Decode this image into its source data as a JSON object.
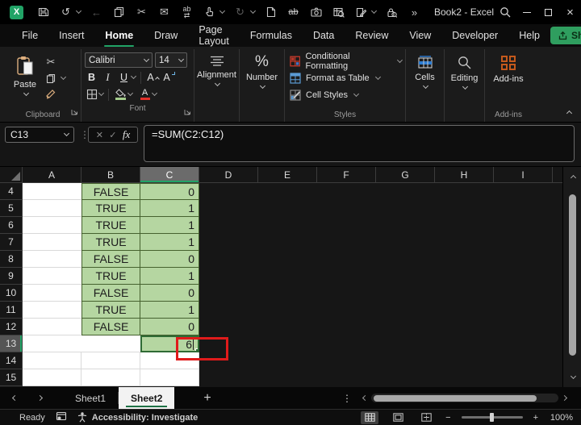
{
  "window": {
    "title": "Book2 - Excel",
    "controls": {
      "close": "×"
    }
  },
  "qat_icons": [
    "excel-logo",
    "save",
    "undo",
    "back",
    "copy",
    "cut",
    "email",
    "find-replace",
    "touch-mouse-mode",
    "redo",
    "new-file",
    "strikethrough",
    "camera",
    "workbook-statistics",
    "edit-form",
    "permissions",
    "more"
  ],
  "qat_text": {
    "replace": "ab",
    "strikethrough": "ab",
    "more": "»"
  },
  "ribbon_tabs": [
    "File",
    "Insert",
    "Home",
    "Draw",
    "Page Layout",
    "Formulas",
    "Data",
    "Review",
    "View",
    "Developer",
    "Help"
  ],
  "active_tab": "Home",
  "share": {
    "label": "Share"
  },
  "ribbon": {
    "clipboard": {
      "paste": "Paste",
      "label": "Clipboard"
    },
    "font": {
      "name": "Calibri",
      "size": "14",
      "bold": "B",
      "italic": "I",
      "underline": "U",
      "increase": "A",
      "decrease": "A",
      "color_a": "A",
      "label": "Font"
    },
    "alignment": {
      "label": "Alignment"
    },
    "number": {
      "symbol": "%",
      "label": "Number"
    },
    "styles": {
      "conditional": "Conditional Formatting",
      "format_table": "Format as Table",
      "cell_styles": "Cell Styles",
      "label": "Styles"
    },
    "cells": {
      "label": "Cells"
    },
    "editing": {
      "label": "Editing"
    },
    "addins": {
      "button": "Add-ins",
      "label": "Add-ins"
    }
  },
  "formula_bar": {
    "name_box": "C13",
    "separator": "⋮",
    "cancel": "✕",
    "enter": "✓",
    "fx": "fx",
    "formula": "=SUM(C2:C12)"
  },
  "grid": {
    "columns": [
      "A",
      "B",
      "C",
      "D",
      "E",
      "F",
      "G",
      "H",
      "I"
    ],
    "active_column": "C",
    "active_cell": "C13",
    "rows": [
      {
        "num": "4",
        "b": "FALSE",
        "c": "0"
      },
      {
        "num": "5",
        "b": "TRUE",
        "c": "1"
      },
      {
        "num": "6",
        "b": "TRUE",
        "c": "1"
      },
      {
        "num": "7",
        "b": "TRUE",
        "c": "1"
      },
      {
        "num": "8",
        "b": "FALSE",
        "c": "0"
      },
      {
        "num": "9",
        "b": "TRUE",
        "c": "1"
      },
      {
        "num": "10",
        "b": "FALSE",
        "c": "0"
      },
      {
        "num": "11",
        "b": "TRUE",
        "c": "1"
      },
      {
        "num": "12",
        "b": "FALSE",
        "c": "0"
      },
      {
        "num": "13",
        "b": "",
        "c": "6"
      },
      {
        "num": "14",
        "b": "",
        "c": ""
      },
      {
        "num": "15",
        "b": "",
        "c": ""
      }
    ]
  },
  "sheet_bar": {
    "sheets": [
      "Sheet1",
      "Sheet2"
    ],
    "active_sheet": "Sheet2",
    "add": "+",
    "more": "⋮"
  },
  "status_bar": {
    "mode": "Ready",
    "accessibility": "Accessibility: Investigate",
    "zoom_out": "−",
    "zoom_in": "+",
    "zoom": "100%"
  },
  "colors": {
    "accent_green": "#21a366",
    "cell_fill_green": "#b5d6a1",
    "cell_border_green": "#46622f",
    "annotation_red": "#e01b1b",
    "addins_icon": "#c4591c",
    "share_button": "#2f9e5f"
  }
}
